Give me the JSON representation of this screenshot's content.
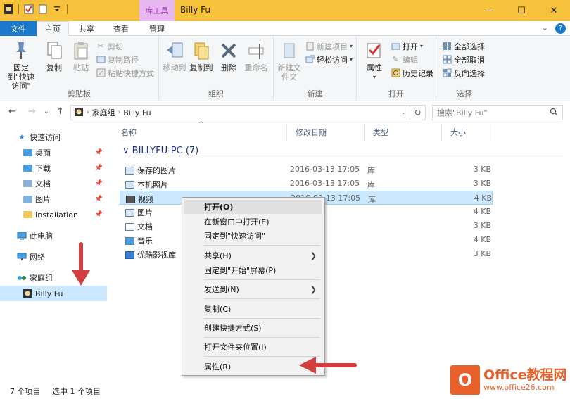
{
  "titlebar": {
    "context_tab": "库工具",
    "title": "Billy Fu",
    "minimize": "—",
    "maximize": "☐",
    "close": "✕",
    "accent_color": "#f7c23b"
  },
  "tabs": {
    "file": "文件",
    "home": "主页",
    "share": "共享",
    "view": "查看",
    "manage": "管理",
    "expand": "⌄",
    "help": "?"
  },
  "ribbon": {
    "clipboard": {
      "label": "剪贴板",
      "pin": "固定到\"快速访问\"",
      "copy": "复制",
      "paste": "粘贴",
      "cut": "剪切",
      "copy_path": "复制路径",
      "paste_shortcut": "粘贴快捷方式"
    },
    "organize": {
      "label": "组织",
      "move_to": "移动到",
      "copy_to": "复制到",
      "delete": "删除",
      "rename": "重命名"
    },
    "new": {
      "label": "新建",
      "new_folder": "新建文件夹",
      "new_item": "新建项目",
      "easy_access": "轻松访问"
    },
    "open": {
      "label": "打开",
      "properties": "属性",
      "open": "打开",
      "edit": "编辑",
      "history": "历史记录"
    },
    "select": {
      "label": "选择",
      "select_all": "全部选择",
      "select_none": "全部取消",
      "invert": "反向选择"
    }
  },
  "address": {
    "crumbs": [
      "家庭组",
      "Billy Fu"
    ],
    "search_placeholder": "搜索\"Billy Fu\""
  },
  "navpane": {
    "quick_access": "快速访问",
    "items": [
      {
        "label": "桌面"
      },
      {
        "label": "下载"
      },
      {
        "label": "文档"
      },
      {
        "label": "图片"
      },
      {
        "label": "Installation"
      }
    ],
    "this_pc": "此电脑",
    "network": "网络",
    "homegroup": "家庭组",
    "user": "Billy Fu"
  },
  "columns": {
    "name": "名称",
    "date": "修改日期",
    "type": "类型",
    "size": "大小"
  },
  "group": {
    "title": "BILLYFU-PC (7)"
  },
  "files": [
    {
      "name": "保存的图片",
      "date": "2016-03-13 17:05",
      "type": "库",
      "size": "3 KB"
    },
    {
      "name": "本机照片",
      "date": "2016-03-13 17:05",
      "type": "库",
      "size": "3 KB"
    },
    {
      "name": "视频",
      "date": "2016-03-13 17:05",
      "type": "库",
      "size": "4 KB"
    },
    {
      "name": "图片",
      "date": "",
      "type": "",
      "size": "4 KB"
    },
    {
      "name": "文档",
      "date": "",
      "type": "",
      "size": "3 KB"
    },
    {
      "name": "音乐",
      "date": "",
      "type": "",
      "size": "4 KB"
    },
    {
      "name": "优酷影视库",
      "date": "",
      "type": "",
      "size": "3 KB"
    }
  ],
  "context_menu": {
    "open": "打开(O)",
    "open_new_window": "在新窗口中打开(E)",
    "pin_quick": "固定到\"快速访问\"",
    "share": "共享(H)",
    "pin_start": "固定到\"开始\"屏幕(P)",
    "send_to": "发送到(N)",
    "copy": "复制(C)",
    "create_shortcut": "创建快捷方式(S)",
    "open_location": "打开文件夹位置(I)",
    "properties": "属性(R)"
  },
  "status": {
    "count": "7 个项目",
    "selected": "选中 1 个项目"
  },
  "watermark": {
    "brand": "Office教程网",
    "url": "www.office26.com"
  }
}
